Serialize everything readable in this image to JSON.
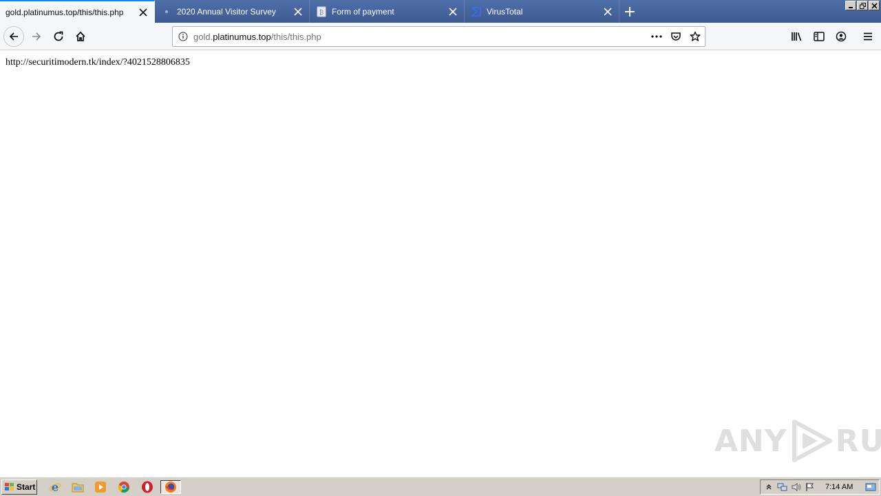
{
  "browser": {
    "tabs": [
      {
        "title": "gold.platinumus.top/this/this.php",
        "active": true,
        "icon": "none"
      },
      {
        "title": "2020 Annual Visitor Survey",
        "active": false,
        "icon": "dot-icon"
      },
      {
        "title": "Form of payment",
        "active": false,
        "icon": "page-icon"
      },
      {
        "title": "VirusTotal",
        "active": false,
        "icon": "virustotal-icon"
      }
    ],
    "url": {
      "prefix": "gold.",
      "host": "platinumus.top",
      "path": "/this/this.php"
    },
    "icons": [
      "back-icon",
      "forward-icon",
      "reload-icon",
      "home-icon",
      "info-icon",
      "page-actions-icon",
      "pocket-icon",
      "bookmark-star-icon",
      "library-icon",
      "sidebar-icon",
      "account-icon",
      "menu-icon",
      "new-tab-icon"
    ]
  },
  "page": {
    "text": "http://securitimodern.tk/index/?4021528806835"
  },
  "watermark": {
    "left": "ANY",
    "right": "RUN"
  },
  "taskbar": {
    "start_label": "Start",
    "quick_launch": [
      "ie-icon",
      "explorer-icon",
      "media-player-icon",
      "chrome-icon",
      "opera-icon",
      "firefox-icon"
    ],
    "tray_icons": [
      "show-hidden-icon",
      "network-icon",
      "volume-icon",
      "action-center-flag-icon"
    ],
    "clock": "7:14 AM"
  },
  "colors": {
    "tabstrip": "#4f6fa8",
    "active_tab": "#f5f6f7",
    "accent": "#0a84ff",
    "taskbar": "#d4d0c8"
  }
}
